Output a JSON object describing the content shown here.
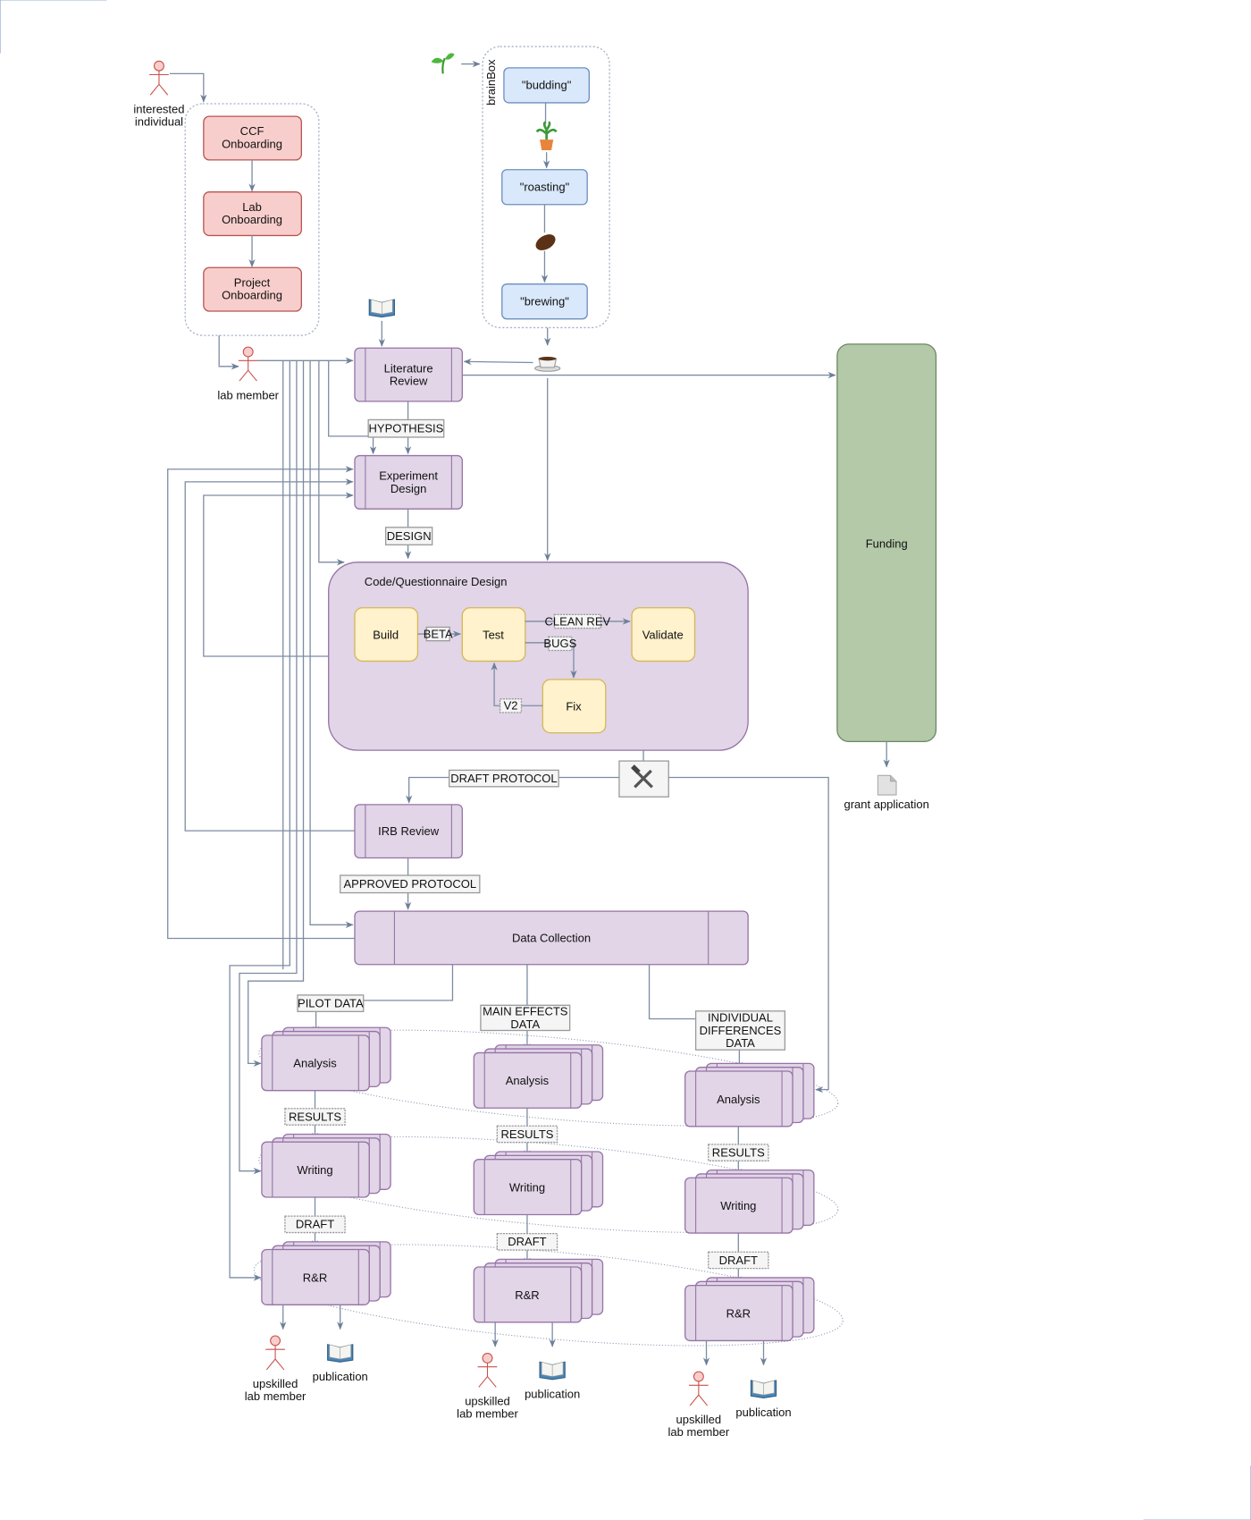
{
  "colors": {
    "onboarding_fill": "#f8cecc",
    "onboarding_stroke": "#b85450",
    "brainbox_fill": "#dae8fc",
    "brainbox_stroke": "#6c8ebf",
    "process_fill": "#e1d5e7",
    "process_stroke": "#9673a6",
    "code_step_fill": "#fff2cc",
    "code_step_stroke": "#d6b656",
    "funding_fill": "#b3c9a8",
    "funding_stroke": "#6d8764",
    "connector": "#7d8ca3"
  },
  "icons": [
    "actor-icon",
    "sprout-icon",
    "potted-plant-icon",
    "coffee-bean-icon",
    "coffee-cup-icon",
    "book-icon",
    "tools-icon",
    "document-icon"
  ],
  "actors": {
    "interested": [
      "interested",
      "individual"
    ],
    "lab_member": "lab member",
    "upskilled": [
      "upskilled",
      "lab member"
    ]
  },
  "onboarding": {
    "ccf": [
      "CCF",
      "Onboarding"
    ],
    "lab": [
      "Lab",
      "Onboarding"
    ],
    "project": [
      "Project",
      "Onboarding"
    ]
  },
  "brainbox": {
    "title": "brainBox",
    "budding": "\"budding\"",
    "roasting": "\"roasting\"",
    "brewing": "\"brewing\""
  },
  "main": {
    "literature_review": [
      "Literature",
      "Review"
    ],
    "hypothesis": "HYPOTHESIS",
    "experiment_design": [
      "Experiment",
      "Design"
    ],
    "design": "DESIGN",
    "draft_protocol": "DRAFT PROTOCOL",
    "irb_review": "IRB Review",
    "approved_protocol": "APPROVED PROTOCOL",
    "data_collection": "Data Collection",
    "funding": "Funding",
    "grant_application": "grant application"
  },
  "code_design": {
    "title": "Code/Questionnaire Design",
    "build": "Build",
    "test": "Test",
    "validate": "Validate",
    "fix": "Fix",
    "beta": "BETA",
    "clean_rev": "CLEAN REV",
    "bugs": "BUGS",
    "v2": "V2"
  },
  "columns": [
    {
      "data_label": [
        "PILOT DATA"
      ],
      "analysis": "Analysis",
      "results": "RESULTS",
      "writing": "Writing",
      "draft": "DRAFT",
      "rr": "R&R",
      "publication": "publication"
    },
    {
      "data_label": [
        "MAIN EFFECTS",
        "DATA"
      ],
      "analysis": "Analysis",
      "results": "RESULTS",
      "writing": "Writing",
      "draft": "DRAFT",
      "rr": "R&R",
      "publication": "publication"
    },
    {
      "data_label": [
        "INDIVIDUAL",
        "DIFFERENCES",
        "DATA"
      ],
      "analysis": "Analysis",
      "results": "RESULTS",
      "writing": "Writing",
      "draft": "DRAFT",
      "rr": "R&R",
      "publication": "publication"
    }
  ]
}
